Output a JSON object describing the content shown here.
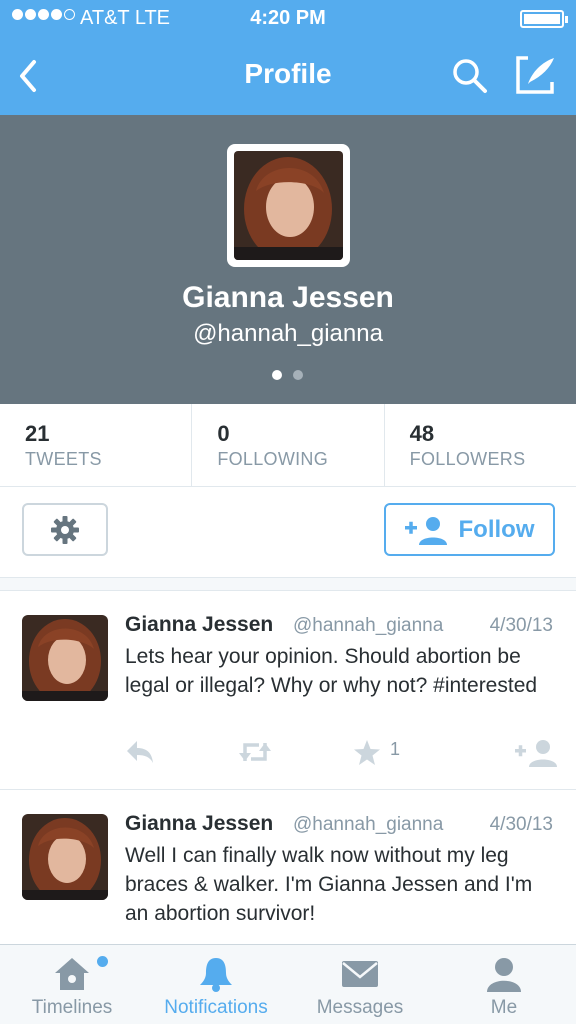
{
  "status_bar": {
    "carrier": "AT&T  LTE",
    "time": "4:20 PM",
    "signal_bars": 4,
    "signal_total": 5
  },
  "nav": {
    "title": "Profile",
    "back_icon": "chevron-left-icon",
    "search_icon": "search-icon",
    "compose_icon": "compose-icon"
  },
  "profile": {
    "name": "Gianna Jessen",
    "handle": "@hannah_gianna",
    "page_count": 2,
    "active_page": 1,
    "header_color": "#66757f"
  },
  "stats": [
    {
      "value": "21",
      "label": "TWEETS"
    },
    {
      "value": "0",
      "label": "FOLLOWING"
    },
    {
      "value": "48",
      "label": "FOLLOWERS"
    }
  ],
  "actions": {
    "settings_icon": "gear-icon",
    "follow_label": "Follow",
    "follow_icon": "add-user-icon"
  },
  "tweets": [
    {
      "name": "Gianna Jessen",
      "handle": "@hannah_gianna",
      "date": "4/30/13",
      "text": "Lets hear your opinion. Should abortion be legal or illegal? Why or why not? #interested",
      "favorites": "1"
    },
    {
      "name": "Gianna Jessen",
      "handle": "@hannah_gianna",
      "date": "4/30/13",
      "text": "Well I can finally walk now without my leg braces & walker. I'm Gianna Jessen and I'm an abortion survivor!",
      "favorites": ""
    }
  ],
  "tabbar": {
    "items": [
      {
        "label": "Timelines",
        "icon": "home-icon",
        "active": false,
        "badge": true
      },
      {
        "label": "Notifications",
        "icon": "bell-icon",
        "active": true,
        "badge": false
      },
      {
        "label": "Messages",
        "icon": "envelope-icon",
        "active": false,
        "badge": false
      },
      {
        "label": "Me",
        "icon": "person-icon",
        "active": false,
        "badge": false
      }
    ]
  },
  "colors": {
    "brand": "#55acee",
    "muted": "#8899a6",
    "text": "#292f33"
  }
}
